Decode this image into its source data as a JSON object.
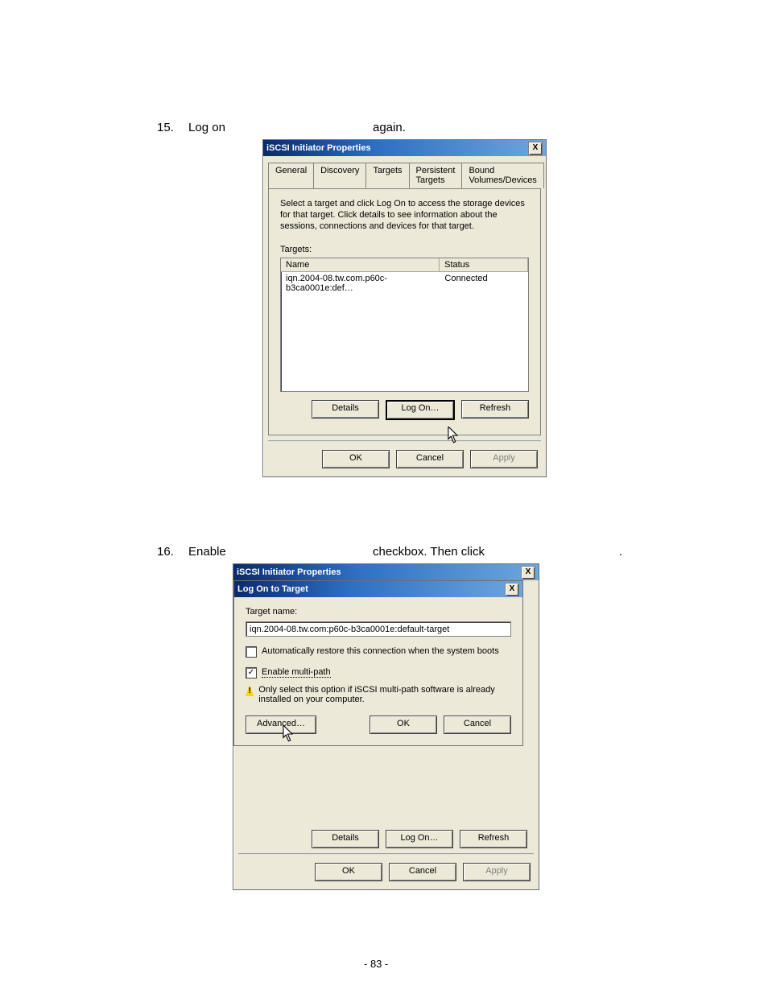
{
  "steps": {
    "s15": {
      "num": "15.",
      "a": "Log on",
      "b": "again."
    },
    "s16": {
      "num": "16.",
      "a": "Enable",
      "b": "checkbox. Then click",
      "c": "."
    }
  },
  "page_number": "- 83 -",
  "dlg1": {
    "title": "iSCSI Initiator Properties",
    "close": "X",
    "tabs": {
      "general": "General",
      "discovery": "Discovery",
      "targets": "Targets",
      "persistent": "Persistent Targets",
      "bound": "Bound Volumes/Devices"
    },
    "instr": "Select a target and click Log On to access the storage devices for that target. Click details to see information about the sessions, connections and devices for that target.",
    "targets_lbl": "Targets:",
    "col_name": "Name",
    "col_status": "Status",
    "row_name": "iqn.2004-08.tw.com.p60c-b3ca0001e:def…",
    "row_status": "Connected",
    "btn_details": "Details",
    "btn_logon": "Log On…",
    "btn_refresh": "Refresh",
    "ok": "OK",
    "cancel": "Cancel",
    "apply": "Apply"
  },
  "dlg2": {
    "outer_title": "iSCSI Initiator Properties",
    "modal_title": "Log On to Target",
    "close": "X",
    "target_name_lbl": "Target name:",
    "target_name": "iqn.2004-08.tw.com:p60c-b3ca0001e:default-target",
    "chk_auto": "Automatically restore this connection when the system boots",
    "chk_multi": "Enable multi-path",
    "warn": "Only select this option if iSCSI multi-path software is already installed on your computer.",
    "advanced": "Advanced…",
    "ok": "OK",
    "cancel": "Cancel",
    "btn_details": "Details",
    "btn_logon": "Log On…",
    "btn_refresh": "Refresh",
    "apply": "Apply"
  }
}
